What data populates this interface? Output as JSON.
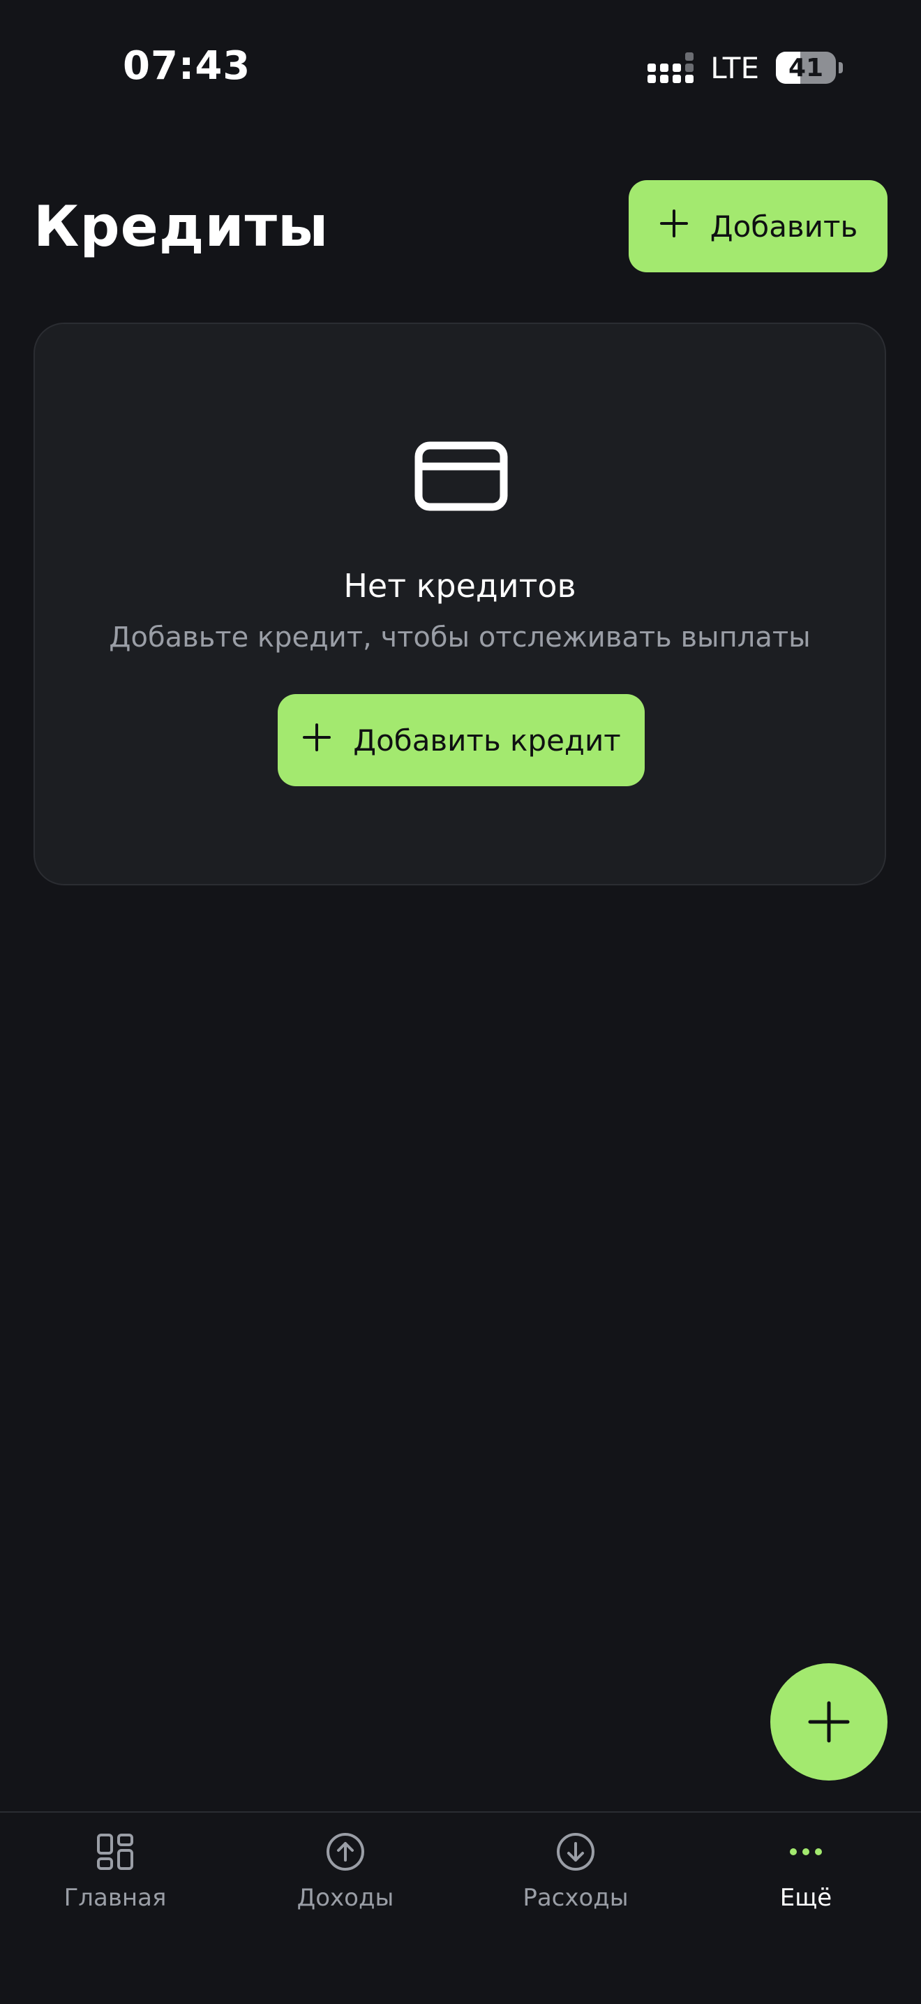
{
  "status_bar": {
    "time": "07:43",
    "network": "LTE",
    "battery": "41",
    "battery_level": 0.41
  },
  "header": {
    "title": "Кредиты",
    "add_button_label": "Добавить",
    "add_button_icon": "plus-icon"
  },
  "empty_state": {
    "icon": "credit-card-icon",
    "title": "Нет кредитов",
    "subtitle": "Добавьте кредит, чтобы отслеживать выплаты",
    "button_label": "Добавить кредит",
    "button_icon": "plus-icon"
  },
  "fab": {
    "icon": "plus-icon"
  },
  "bottom_nav": {
    "items": [
      {
        "label": "Главная",
        "icon": "dashboard-grid-icon",
        "active": false
      },
      {
        "label": "Доходы",
        "icon": "arrow-up-circle-icon",
        "active": false
      },
      {
        "label": "Расходы",
        "icon": "arrow-down-circle-icon",
        "active": false
      },
      {
        "label": "Ещё",
        "icon": "more-dots-icon",
        "active": true
      }
    ]
  },
  "colors": {
    "background": "#131418",
    "card": "#1c1e22",
    "accent": "#a3e96f",
    "muted_text": "#9a9ea6"
  }
}
